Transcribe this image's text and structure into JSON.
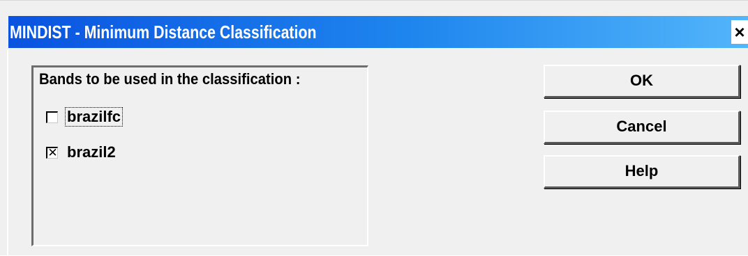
{
  "window": {
    "title": "MINDIST - Minimum Distance Classification",
    "close_glyph": "×"
  },
  "bands": {
    "label": "Bands to be used in the classification :",
    "items": [
      {
        "label": "brazilfc",
        "checked": false,
        "focused": true,
        "mark": ""
      },
      {
        "label": "brazil2",
        "checked": true,
        "focused": false,
        "mark": "✕"
      }
    ]
  },
  "buttons": {
    "ok": "OK",
    "cancel": "Cancel",
    "help": "Help"
  },
  "colors": {
    "titlebar_start": "#0a53e0",
    "titlebar_end": "#53b5fa",
    "dialog_bg": "#f0f0f0"
  }
}
